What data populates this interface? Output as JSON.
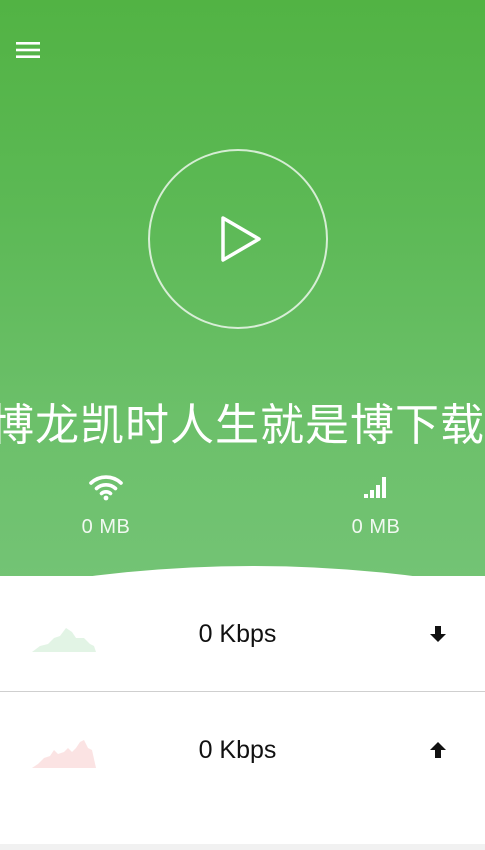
{
  "header": {
    "menu_icon": "hamburger-menu-icon",
    "play_icon": "play-icon",
    "marquee_text": "博龙凯时人生就是博下载",
    "wifi": {
      "icon": "wifi-icon",
      "value": "0 MB"
    },
    "mobile": {
      "icon": "cellular-signal-icon",
      "value": "0 MB"
    }
  },
  "download": {
    "speed": "0 Kbps",
    "icon": "download-arrow-icon",
    "graph_color": "#e2f4e5"
  },
  "upload": {
    "speed": "0 Kbps",
    "icon": "upload-arrow-icon",
    "graph_color": "#fbe3e3"
  },
  "colors": {
    "brand_green": "#5cb955",
    "white": "#ffffff"
  }
}
